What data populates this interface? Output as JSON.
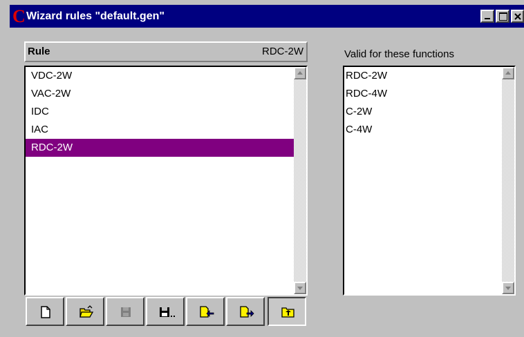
{
  "window": {
    "title": "Wizard rules \"default.gen\"",
    "app_icon": "C"
  },
  "rules": {
    "header_label": "Rule",
    "current_rule": "RDC-2W",
    "items": [
      {
        "label": "VDC-2W",
        "selected": false
      },
      {
        "label": "VAC-2W",
        "selected": false
      },
      {
        "label": "IDC",
        "selected": false
      },
      {
        "label": "IAC",
        "selected": false
      },
      {
        "label": "RDC-2W",
        "selected": true
      }
    ]
  },
  "functions": {
    "label": "Valid for these functions",
    "items": [
      "RDC-2W",
      "RDC-4W",
      "C-2W",
      "C-4W"
    ]
  },
  "toolbar": {
    "buttons": [
      {
        "name": "new-file-icon",
        "enabled": true
      },
      {
        "name": "open-folder-icon",
        "enabled": true
      },
      {
        "name": "save-icon",
        "enabled": false
      },
      {
        "name": "save-as-icon",
        "enabled": true
      },
      {
        "name": "import-icon",
        "enabled": true
      },
      {
        "name": "export-icon",
        "enabled": true
      },
      {
        "name": "folder-up-icon",
        "enabled": true
      }
    ]
  },
  "colors": {
    "titlebar": "#000080",
    "selection": "#800080",
    "face": "#c0c0c0"
  }
}
